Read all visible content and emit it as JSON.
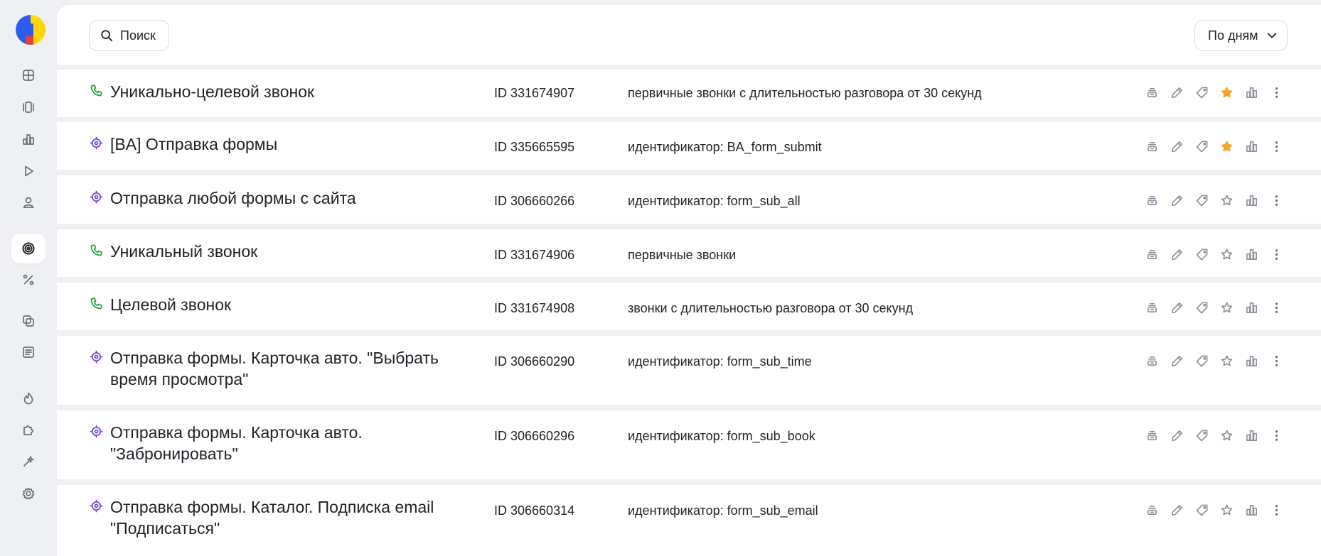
{
  "colors": {
    "accent_call": "#22a33a",
    "accent_goal": "#7a44c8",
    "favorite": "#f5a623",
    "logo_blue": "#2b5cf2",
    "logo_yellow": "#ffd60a",
    "logo_red": "#f0402e"
  },
  "sidebar": {
    "items": [
      {
        "icon": "dashboard-icon"
      },
      {
        "icon": "carousel-icon"
      },
      {
        "icon": "bar-chart-icon"
      },
      {
        "icon": "play-icon"
      },
      {
        "icon": "user-icon"
      },
      {
        "icon": "target-icon",
        "active": true
      },
      {
        "icon": "percent-icon"
      },
      {
        "icon": "layers-icon"
      },
      {
        "icon": "news-icon"
      },
      {
        "icon": "fire-icon"
      },
      {
        "icon": "puzzle-icon"
      },
      {
        "icon": "magic-icon"
      },
      {
        "icon": "gear-icon"
      }
    ]
  },
  "toolbar": {
    "search_label": "Поиск",
    "period_label": "По дням"
  },
  "goals": [
    {
      "type": "call",
      "name": "Уникально-целевой звонок",
      "id": "ID 331674907",
      "description": "первичные звонки с длительностью разговора от 30 секунд",
      "favorite": true
    },
    {
      "type": "goal",
      "name": "[BA] Отправка формы",
      "id": "ID 335665595",
      "description": "идентификатор: BA_form_submit",
      "favorite": true
    },
    {
      "type": "goal",
      "name": "Отправка любой формы с сайта",
      "id": "ID 306660266",
      "description": "идентификатор: form_sub_all",
      "favorite": false
    },
    {
      "type": "call",
      "name": "Уникальный звонок",
      "id": "ID 331674906",
      "description": "первичные звонки",
      "favorite": false
    },
    {
      "type": "call",
      "name": "Целевой звонок",
      "id": "ID 331674908",
      "description": "звонки с длительностью разговора от 30 секунд",
      "favorite": false
    },
    {
      "type": "goal",
      "name": "Отправка формы. Карточка авто. \"Выбрать время просмотра\"",
      "id": "ID 306660290",
      "description": "идентификатор: form_sub_time",
      "favorite": false
    },
    {
      "type": "goal",
      "name": "Отправка формы. Карточка авто. \"Забронировать\"",
      "id": "ID 306660296",
      "description": "идентификатор: form_sub_book",
      "favorite": false
    },
    {
      "type": "goal",
      "name": "Отправка формы. Каталог. Подписка email \"Подписаться\"",
      "id": "ID 306660314",
      "description": "идентификатор: form_sub_email",
      "favorite": false
    }
  ]
}
